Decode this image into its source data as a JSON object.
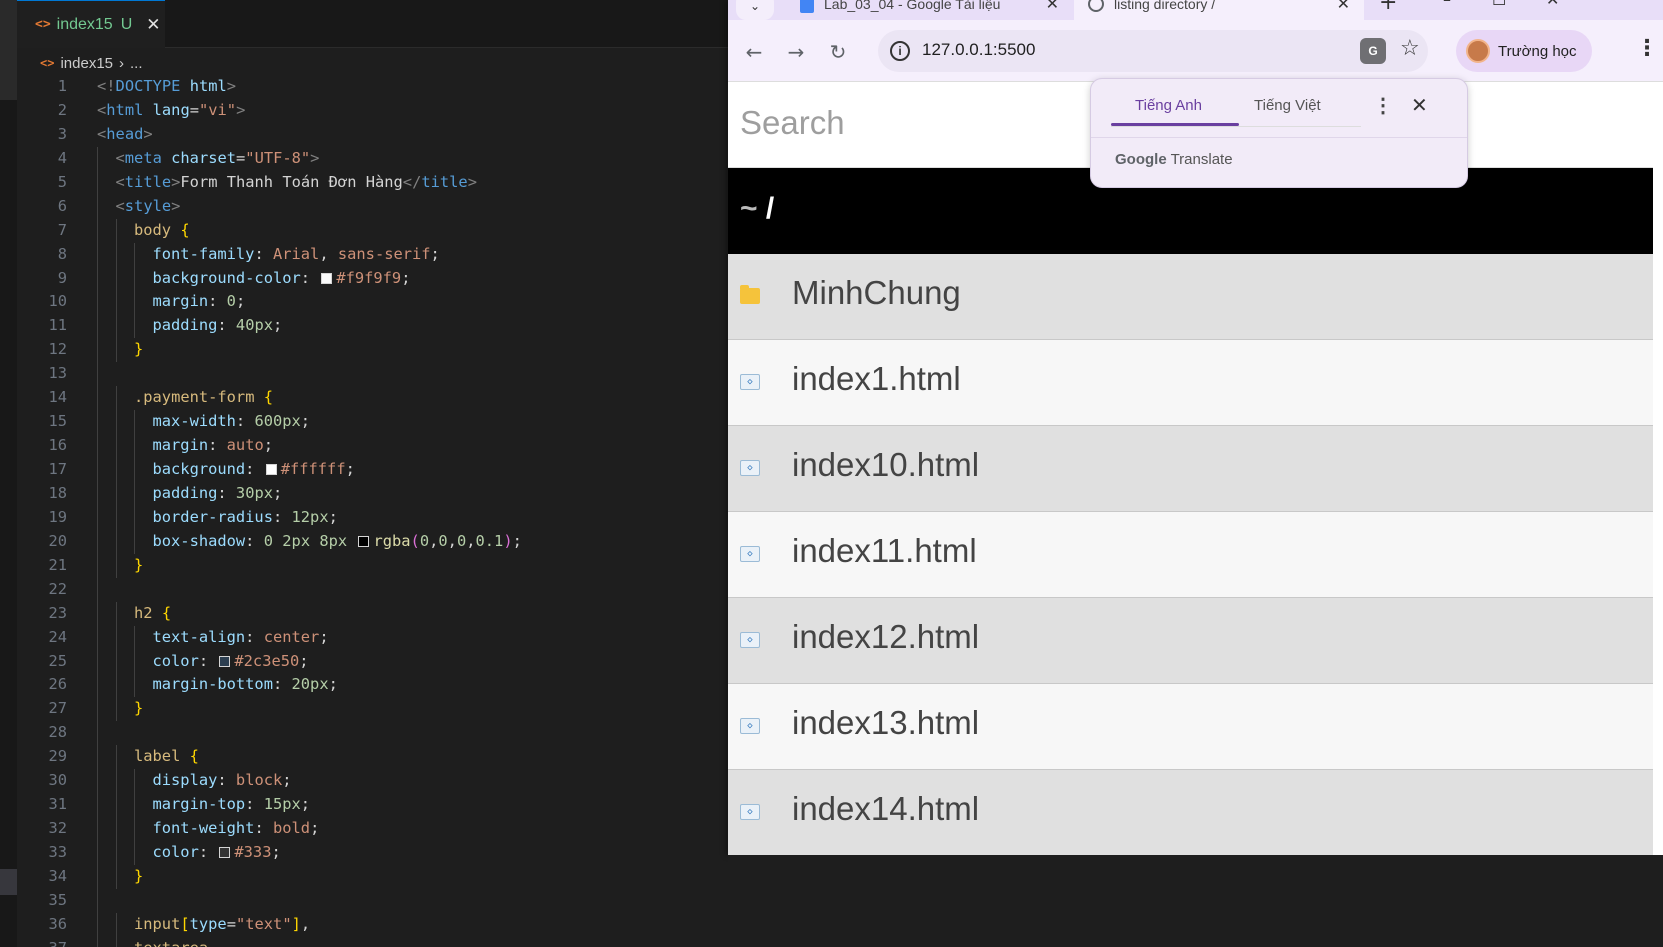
{
  "editor": {
    "tab": {
      "icon": "<>",
      "filename": "index15",
      "status": "U"
    },
    "breadcrumb": {
      "icon": "<>",
      "file": "index15",
      "rest": "..."
    },
    "lines": [
      {
        "n": 1,
        "indent": 0,
        "tokens": [
          [
            "punc",
            "<!"
          ],
          [
            "tag",
            "DOCTYPE"
          ],
          [
            "plain",
            " "
          ],
          [
            "attr",
            "html"
          ],
          [
            "punc",
            ">"
          ]
        ]
      },
      {
        "n": 2,
        "indent": 0,
        "tokens": [
          [
            "punc",
            "<"
          ],
          [
            "tag",
            "html"
          ],
          [
            "plain",
            " "
          ],
          [
            "attr",
            "lang"
          ],
          [
            "plain",
            "="
          ],
          [
            "str",
            "\"vi\""
          ],
          [
            "punc",
            ">"
          ]
        ]
      },
      {
        "n": 3,
        "indent": 0,
        "tokens": [
          [
            "punc",
            "<"
          ],
          [
            "tag",
            "head"
          ],
          [
            "punc",
            ">"
          ]
        ]
      },
      {
        "n": 4,
        "indent": 1,
        "tokens": [
          [
            "punc",
            "<"
          ],
          [
            "tag",
            "meta"
          ],
          [
            "plain",
            " "
          ],
          [
            "attr",
            "charset"
          ],
          [
            "plain",
            "="
          ],
          [
            "str",
            "\"UTF-8\""
          ],
          [
            "punc",
            ">"
          ]
        ]
      },
      {
        "n": 5,
        "indent": 1,
        "tokens": [
          [
            "punc",
            "<"
          ],
          [
            "tag",
            "title"
          ],
          [
            "punc",
            ">"
          ],
          [
            "text",
            "Form Thanh Toán Đơn Hàng"
          ],
          [
            "punc",
            "</"
          ],
          [
            "tag",
            "title"
          ],
          [
            "punc",
            ">"
          ]
        ]
      },
      {
        "n": 6,
        "indent": 1,
        "tokens": [
          [
            "punc",
            "<"
          ],
          [
            "tag",
            "style"
          ],
          [
            "punc",
            ">"
          ]
        ]
      },
      {
        "n": 7,
        "indent": 2,
        "tokens": [
          [
            "sel",
            "body"
          ],
          [
            "plain",
            " "
          ],
          [
            "brace",
            "{"
          ]
        ]
      },
      {
        "n": 8,
        "indent": 3,
        "tokens": [
          [
            "prop",
            "font-family"
          ],
          [
            "plain",
            ": "
          ],
          [
            "val",
            "Arial"
          ],
          [
            "plain",
            ", "
          ],
          [
            "val",
            "sans-serif"
          ],
          [
            "plain",
            ";"
          ]
        ]
      },
      {
        "n": 9,
        "indent": 3,
        "tokens": [
          [
            "prop",
            "background-color"
          ],
          [
            "plain",
            ": "
          ],
          [
            "swatch",
            "#f9f9f9"
          ],
          [
            "val",
            "#f9f9f9"
          ],
          [
            "plain",
            ";"
          ]
        ]
      },
      {
        "n": 10,
        "indent": 3,
        "tokens": [
          [
            "prop",
            "margin"
          ],
          [
            "plain",
            ": "
          ],
          [
            "num",
            "0"
          ],
          [
            "plain",
            ";"
          ]
        ]
      },
      {
        "n": 11,
        "indent": 3,
        "tokens": [
          [
            "prop",
            "padding"
          ],
          [
            "plain",
            ": "
          ],
          [
            "num",
            "40px"
          ],
          [
            "plain",
            ";"
          ]
        ]
      },
      {
        "n": 12,
        "indent": 2,
        "tokens": [
          [
            "brace",
            "}"
          ]
        ]
      },
      {
        "n": 13,
        "indent": 0,
        "tokens": []
      },
      {
        "n": 14,
        "indent": 2,
        "tokens": [
          [
            "sel",
            ".payment-form"
          ],
          [
            "plain",
            " "
          ],
          [
            "brace",
            "{"
          ]
        ]
      },
      {
        "n": 15,
        "indent": 3,
        "tokens": [
          [
            "prop",
            "max-width"
          ],
          [
            "plain",
            ": "
          ],
          [
            "num",
            "600px"
          ],
          [
            "plain",
            ";"
          ]
        ]
      },
      {
        "n": 16,
        "indent": 3,
        "tokens": [
          [
            "prop",
            "margin"
          ],
          [
            "plain",
            ": "
          ],
          [
            "val",
            "auto"
          ],
          [
            "plain",
            ";"
          ]
        ]
      },
      {
        "n": 17,
        "indent": 3,
        "tokens": [
          [
            "prop",
            "background"
          ],
          [
            "plain",
            ": "
          ],
          [
            "swatch",
            "#ffffff"
          ],
          [
            "val",
            "#ffffff"
          ],
          [
            "plain",
            ";"
          ]
        ]
      },
      {
        "n": 18,
        "indent": 3,
        "tokens": [
          [
            "prop",
            "padding"
          ],
          [
            "plain",
            ": "
          ],
          [
            "num",
            "30px"
          ],
          [
            "plain",
            ";"
          ]
        ]
      },
      {
        "n": 19,
        "indent": 3,
        "tokens": [
          [
            "prop",
            "border-radius"
          ],
          [
            "plain",
            ": "
          ],
          [
            "num",
            "12px"
          ],
          [
            "plain",
            ";"
          ]
        ]
      },
      {
        "n": 20,
        "indent": 3,
        "tokens": [
          [
            "prop",
            "box-shadow"
          ],
          [
            "plain",
            ": "
          ],
          [
            "num",
            "0"
          ],
          [
            "plain",
            " "
          ],
          [
            "num",
            "2px"
          ],
          [
            "plain",
            " "
          ],
          [
            "num",
            "8px"
          ],
          [
            "plain",
            " "
          ],
          [
            "swatch",
            "#000000"
          ],
          [
            "fn",
            "rgba"
          ],
          [
            "paren",
            "("
          ],
          [
            "num",
            "0"
          ],
          [
            "plain",
            ","
          ],
          [
            "num",
            "0"
          ],
          [
            "plain",
            ","
          ],
          [
            "num",
            "0"
          ],
          [
            "plain",
            ","
          ],
          [
            "num",
            "0.1"
          ],
          [
            "paren",
            ")"
          ],
          [
            "plain",
            ";"
          ]
        ]
      },
      {
        "n": 21,
        "indent": 2,
        "tokens": [
          [
            "brace",
            "}"
          ]
        ]
      },
      {
        "n": 22,
        "indent": 0,
        "tokens": []
      },
      {
        "n": 23,
        "indent": 2,
        "tokens": [
          [
            "sel",
            "h2"
          ],
          [
            "plain",
            " "
          ],
          [
            "brace",
            "{"
          ]
        ]
      },
      {
        "n": 24,
        "indent": 3,
        "tokens": [
          [
            "prop",
            "text-align"
          ],
          [
            "plain",
            ": "
          ],
          [
            "val",
            "center"
          ],
          [
            "plain",
            ";"
          ]
        ]
      },
      {
        "n": 25,
        "indent": 3,
        "tokens": [
          [
            "prop",
            "color"
          ],
          [
            "plain",
            ": "
          ],
          [
            "swatch",
            "#2c3e50"
          ],
          [
            "val",
            "#2c3e50"
          ],
          [
            "plain",
            ";"
          ]
        ]
      },
      {
        "n": 26,
        "indent": 3,
        "tokens": [
          [
            "prop",
            "margin-bottom"
          ],
          [
            "plain",
            ": "
          ],
          [
            "num",
            "20px"
          ],
          [
            "plain",
            ";"
          ]
        ]
      },
      {
        "n": 27,
        "indent": 2,
        "tokens": [
          [
            "brace",
            "}"
          ]
        ]
      },
      {
        "n": 28,
        "indent": 0,
        "tokens": []
      },
      {
        "n": 29,
        "indent": 2,
        "tokens": [
          [
            "sel",
            "label"
          ],
          [
            "plain",
            " "
          ],
          [
            "brace",
            "{"
          ]
        ]
      },
      {
        "n": 30,
        "indent": 3,
        "tokens": [
          [
            "prop",
            "display"
          ],
          [
            "plain",
            ": "
          ],
          [
            "val",
            "block"
          ],
          [
            "plain",
            ";"
          ]
        ]
      },
      {
        "n": 31,
        "indent": 3,
        "tokens": [
          [
            "prop",
            "margin-top"
          ],
          [
            "plain",
            ": "
          ],
          [
            "num",
            "15px"
          ],
          [
            "plain",
            ";"
          ]
        ]
      },
      {
        "n": 32,
        "indent": 3,
        "tokens": [
          [
            "prop",
            "font-weight"
          ],
          [
            "plain",
            ": "
          ],
          [
            "val",
            "bold"
          ],
          [
            "plain",
            ";"
          ]
        ]
      },
      {
        "n": 33,
        "indent": 3,
        "tokens": [
          [
            "prop",
            "color"
          ],
          [
            "plain",
            ": "
          ],
          [
            "swatch",
            "#333333"
          ],
          [
            "val",
            "#333"
          ],
          [
            "plain",
            ";"
          ]
        ]
      },
      {
        "n": 34,
        "indent": 2,
        "tokens": [
          [
            "brace",
            "}"
          ]
        ]
      },
      {
        "n": 35,
        "indent": 0,
        "tokens": []
      },
      {
        "n": 36,
        "indent": 2,
        "tokens": [
          [
            "sel",
            "input"
          ],
          [
            "brace",
            "["
          ],
          [
            "attr",
            "type"
          ],
          [
            "plain",
            "="
          ],
          [
            "str",
            "\"text\""
          ],
          [
            "brace",
            "]"
          ],
          [
            "plain",
            ","
          ]
        ]
      },
      {
        "n": 37,
        "indent": 2,
        "tokens": [
          [
            "sel",
            "textarea"
          ],
          [
            "plain",
            ","
          ]
        ]
      }
    ]
  },
  "browser": {
    "tabs": [
      {
        "title": "Lab_03_04 - Google Tài liệu",
        "icon": "docs-icon"
      },
      {
        "title": "listing directory /",
        "icon": "globe-icon",
        "active": true
      }
    ],
    "url": "127.0.0.1:5500",
    "profile_name": "Trường học",
    "search_placeholder": "Search",
    "path": {
      "tilde": "~",
      "slash": "/"
    },
    "entries": [
      {
        "name": "MinhChung",
        "type": "folder"
      },
      {
        "name": "index1.html",
        "type": "file"
      },
      {
        "name": "index10.html",
        "type": "file"
      },
      {
        "name": "index11.html",
        "type": "file"
      },
      {
        "name": "index12.html",
        "type": "file"
      },
      {
        "name": "index13.html",
        "type": "file"
      },
      {
        "name": "index14.html",
        "type": "file"
      }
    ],
    "translate_popup": {
      "tabs": [
        "Tiếng Anh",
        "Tiếng Việt"
      ],
      "active_tab": 0,
      "brand_google": "Google",
      "brand_translate": "Translate"
    }
  }
}
